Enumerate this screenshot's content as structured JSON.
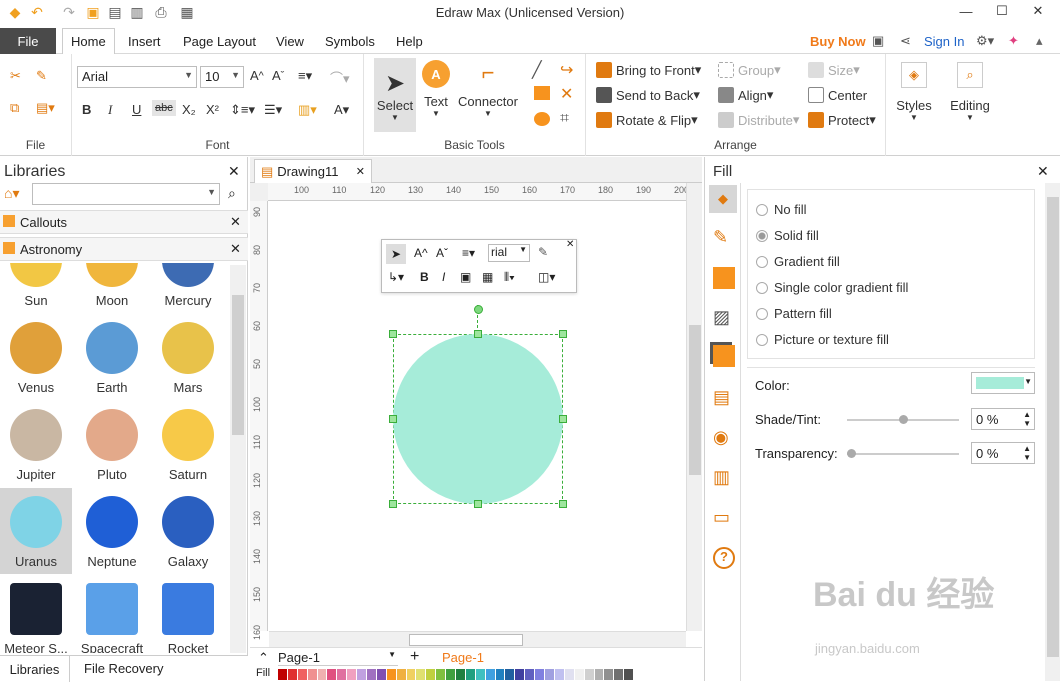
{
  "window": {
    "title": "Edraw Max (Unlicensed Version)"
  },
  "titlebar_icons": [
    "undo-icon",
    "redo-icon",
    "new-icon",
    "open-icon",
    "save-icon",
    "print-icon",
    "export-icon"
  ],
  "menu": {
    "file": "File",
    "tabs": [
      "Home",
      "Insert",
      "Page Layout",
      "View",
      "Symbols",
      "Help"
    ],
    "buy_now": "Buy Now",
    "sign_in": "Sign In"
  },
  "ribbon": {
    "file_group": "File",
    "font_group": "Font",
    "font_name": "Arial",
    "font_size": "10",
    "basic_tools_group": "Basic Tools",
    "select": "Select",
    "text": "Text",
    "connector": "Connector",
    "arrange_group": "Arrange",
    "bring_to_front": "Bring to Front",
    "send_to_back": "Send to Back",
    "rotate_flip": "Rotate & Flip",
    "group": "Group",
    "align": "Align",
    "distribute": "Distribute",
    "size": "Size",
    "center": "Center",
    "protect": "Protect",
    "styles": "Styles",
    "editing": "Editing"
  },
  "libraries": {
    "title": "Libraries",
    "categories": [
      "Callouts",
      "Astronomy"
    ],
    "items": [
      {
        "label": "Sun",
        "color": "#f2c744"
      },
      {
        "label": "Moon",
        "color": "#f0b63c"
      },
      {
        "label": "Mercury",
        "color": "#3d6bb3"
      },
      {
        "label": "Venus",
        "color": "#e0a03a"
      },
      {
        "label": "Earth",
        "color": "#5b9bd5"
      },
      {
        "label": "Mars",
        "color": "#e8c24a"
      },
      {
        "label": "Jupiter",
        "color": "#c9b7a3"
      },
      {
        "label": "Pluto",
        "color": "#e3a98a"
      },
      {
        "label": "Saturn",
        "color": "#f7c948"
      },
      {
        "label": "Uranus",
        "color": "#7fd3e6"
      },
      {
        "label": "Neptune",
        "color": "#1f5fd6"
      },
      {
        "label": "Galaxy",
        "color": "#2a5fc0"
      },
      {
        "label": "Meteor S...",
        "color": "#1a2233"
      },
      {
        "label": "Spacecraft",
        "color": "#5aa0e8"
      },
      {
        "label": "Rocket",
        "color": "#3a7be0"
      }
    ],
    "bottom_tabs": [
      "Libraries",
      "File Recovery"
    ]
  },
  "document": {
    "tab": "Drawing11",
    "ruler_top": [
      "100",
      "110",
      "120",
      "130",
      "140",
      "150",
      "160",
      "170",
      "180",
      "190",
      "200"
    ],
    "ruler_left": [
      "90",
      "80",
      "70",
      "60",
      "50",
      "100",
      "110",
      "120",
      "130",
      "140",
      "150",
      "160"
    ],
    "mini_font": "rial",
    "page_selector": "Page-1",
    "page_tab": "Page-1",
    "fill_label": "Fill"
  },
  "fill_panel": {
    "title": "Fill",
    "options": [
      "No fill",
      "Solid fill",
      "Gradient fill",
      "Single color gradient fill",
      "Pattern fill",
      "Picture or texture fill"
    ],
    "selected": "Solid fill",
    "color_label": "Color:",
    "color_value": "#a6ecd9",
    "shade_label": "Shade/Tint:",
    "shade_value": "0 %",
    "transparency_label": "Transparency:",
    "transparency_value": "0 %"
  },
  "shape": {
    "fill": "#a6ecd9"
  },
  "watermark": {
    "line1": "Bai du 经验",
    "line2": "jingyan.baidu.com"
  }
}
